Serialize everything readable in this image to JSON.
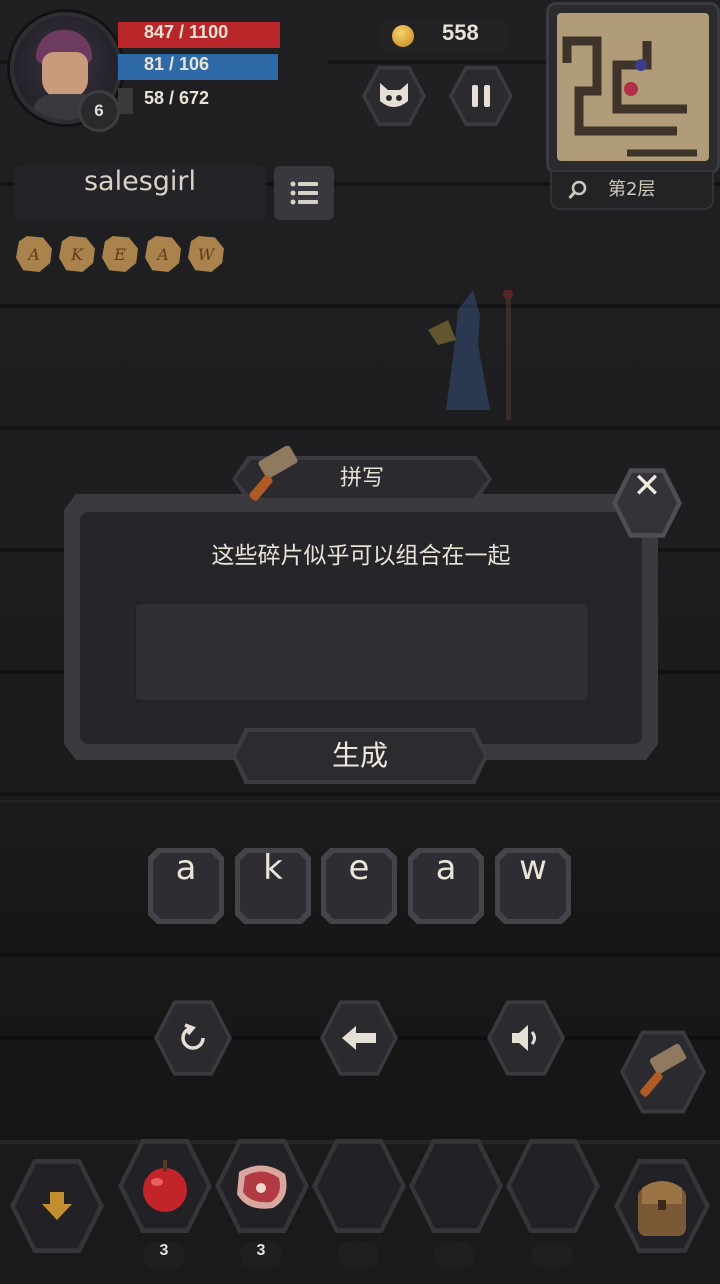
{
  "player": {
    "level": "6",
    "hp": "847 / 1100",
    "mp": "81 / 106",
    "xp": "58 / 672",
    "hp_fraction": 0.77,
    "mp_fraction": 0.76,
    "xp_fraction": 0.086
  },
  "gold": "558",
  "floor_label": "第2层",
  "target_word": "salesgirl",
  "collected_runes": [
    "A",
    "K",
    "E",
    "A",
    "W"
  ],
  "dialog": {
    "title": "拼写",
    "prompt": "这些碎片似乎可以组合在一起",
    "answer_value": "",
    "generate_label": "生成",
    "close_label": "✕"
  },
  "letter_tiles": [
    "a",
    "k",
    "e",
    "a",
    "w"
  ],
  "inventory": {
    "slots": [
      {
        "item": "apple-icon",
        "count": "3"
      },
      {
        "item": "meat-icon",
        "count": "3"
      },
      {
        "item": "",
        "count": ""
      },
      {
        "item": "",
        "count": ""
      },
      {
        "item": "",
        "count": ""
      }
    ]
  },
  "colors": {
    "hp": "#b8262a",
    "mp": "#2e6aa8",
    "rune": "#a9824c"
  }
}
